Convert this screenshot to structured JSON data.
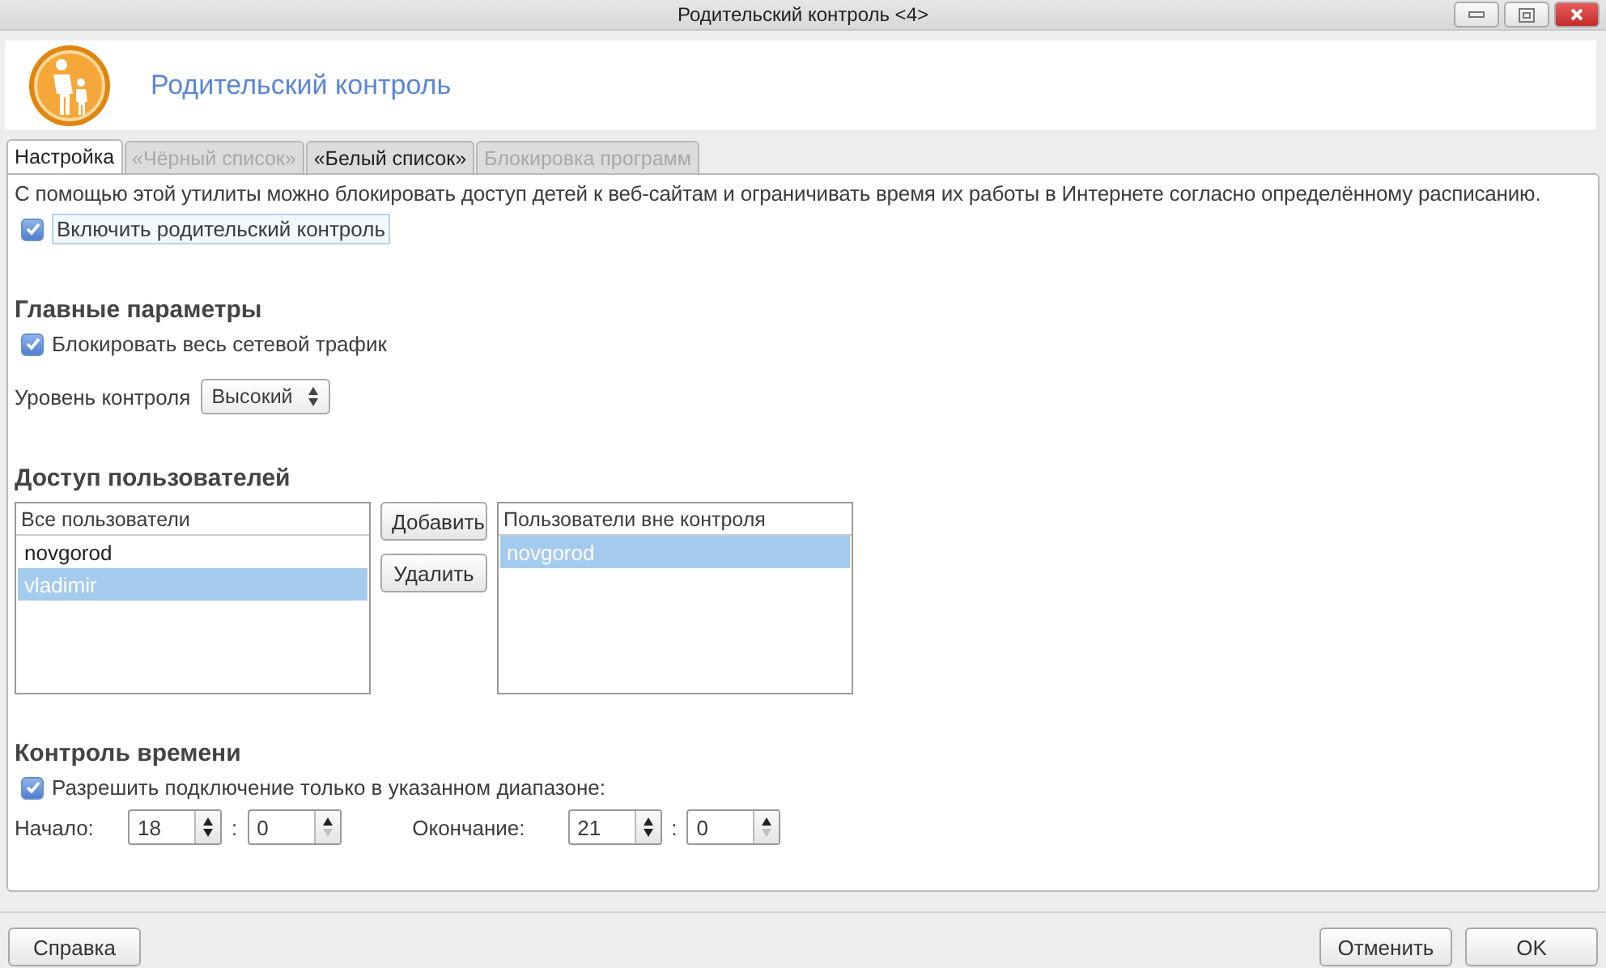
{
  "window": {
    "title": "Родительский контроль <4>"
  },
  "header": {
    "title": "Родительский контроль"
  },
  "tabs": [
    {
      "label": "Настройка",
      "selected": true,
      "disabled": false
    },
    {
      "label": "«Чёрный список»",
      "selected": false,
      "disabled": true
    },
    {
      "label": "«Белый список»",
      "selected": false,
      "disabled": false
    },
    {
      "label": "Блокировка программ",
      "selected": false,
      "disabled": true
    }
  ],
  "description": "С помощью этой утилиты можно блокировать доступ детей к веб-сайтам и ограничивать время их работы в Интернете согласно определённому расписанию.",
  "enable": {
    "label": "Включить родительский контроль",
    "checked": true
  },
  "main_params": {
    "heading": "Главные параметры",
    "block_all": {
      "label": "Блокировать весь сетевой трафик",
      "checked": true
    },
    "level_label": "Уровень контроля",
    "level_value": "Высокий"
  },
  "users": {
    "heading": "Доступ пользователей",
    "all_users": {
      "header": "Все пользователи",
      "items": [
        {
          "name": "novgorod",
          "selected": false
        },
        {
          "name": "vladimir",
          "selected": true
        }
      ]
    },
    "buttons": [
      "Добавить",
      "Удалить"
    ],
    "excluded": {
      "header": "Пользователи вне контроля",
      "items": [
        {
          "name": "novgorod",
          "selected": true
        }
      ]
    }
  },
  "time": {
    "heading": "Контроль времени",
    "restrict": {
      "label": "Разрешить подключение только в указанном диапазоне:",
      "checked": true
    },
    "start": {
      "label": "Начало:",
      "hours": "18",
      "minutes": "0"
    },
    "end": {
      "label": "Окончание:",
      "hours": "21",
      "minutes": "0"
    },
    "separator": ":"
  },
  "footer": {
    "help": "Справка",
    "cancel": "Отменить",
    "ok": "OK"
  }
}
